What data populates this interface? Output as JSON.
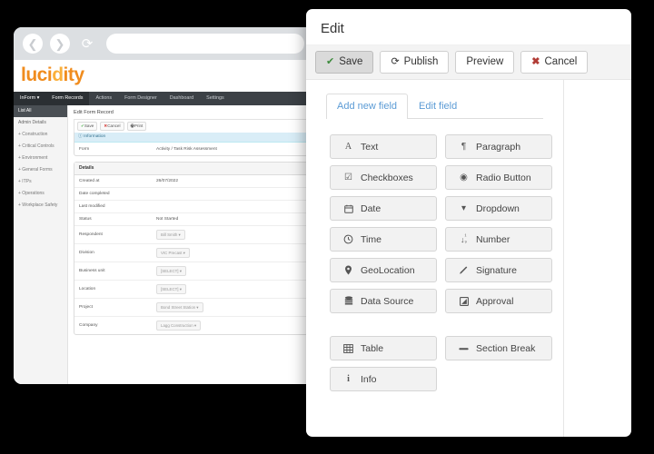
{
  "browser": {
    "back_icon": "chevron-left-icon",
    "forward_icon": "chevron-right-icon",
    "reload_icon": "reload-icon",
    "url_value": "",
    "url_placeholder": ""
  },
  "app": {
    "logo_part1": "luci",
    "logo_part2": "d",
    "logo_part3": "ity",
    "nav": [
      {
        "label": "InForm ▾",
        "active": true
      },
      {
        "label": "Form Records",
        "active": true
      },
      {
        "label": "Actions",
        "active": false
      },
      {
        "label": "Form Designer",
        "active": false
      },
      {
        "label": "Dashboard",
        "active": false
      },
      {
        "label": "Settings",
        "active": false
      }
    ],
    "sidebar": [
      {
        "label": "List All",
        "active": true
      },
      {
        "label": "Admin Details",
        "active": false
      },
      {
        "label": "+ Construction",
        "active": false
      },
      {
        "label": "+ Critical Controls",
        "active": false
      },
      {
        "label": "+ Environment",
        "active": false
      },
      {
        "label": "+ General Forms",
        "active": false
      },
      {
        "label": "+ ITPs",
        "active": false
      },
      {
        "label": "+ Operations",
        "active": false
      },
      {
        "label": "+ Workplace Safety",
        "active": false
      }
    ],
    "record": {
      "title": "Edit Form Record",
      "toolbar": [
        {
          "label": "Save",
          "icon": "check-icon"
        },
        {
          "label": "Cancel",
          "icon": "cross-icon"
        },
        {
          "label": "Print",
          "icon": "printer-icon"
        }
      ],
      "information_header": "Information",
      "information_icon": "info-icon",
      "information_rows": [
        {
          "label": "Form",
          "value": "Activity / Task Risk Assessment",
          "type": "text"
        }
      ],
      "details_header": "Details",
      "details_rows": [
        {
          "label": "Created at",
          "value": "26/07/2022",
          "type": "text"
        },
        {
          "label": "Date completed",
          "value": "",
          "type": "text"
        },
        {
          "label": "Last modified",
          "value": "",
          "type": "text"
        },
        {
          "label": "Status",
          "value": "Not Started",
          "type": "text"
        },
        {
          "label": "Respondent",
          "value": "Bill Smith ▾",
          "type": "pill"
        },
        {
          "label": "Division",
          "value": "VIC Precast ▾",
          "type": "pill"
        },
        {
          "label": "Business unit",
          "value": "[SELECT] ▾",
          "type": "pill"
        },
        {
          "label": "Location",
          "value": "[SELECT] ▾",
          "type": "pill"
        },
        {
          "label": "Project",
          "value": "Bond Street Station ▾",
          "type": "pill"
        },
        {
          "label": "Company",
          "value": "Lagg Construction ▾",
          "type": "pill"
        }
      ]
    }
  },
  "modal": {
    "title": "Edit",
    "toolbar": [
      {
        "label": "Save",
        "icon": "check-icon",
        "icon_glyph": "✔",
        "icon_color": "green",
        "pressed": true
      },
      {
        "label": "Publish",
        "icon": "publish-icon",
        "icon_glyph": "⟳",
        "icon_color": "dark",
        "pressed": false
      },
      {
        "label": "Preview",
        "icon": "",
        "icon_glyph": "",
        "icon_color": "dark",
        "pressed": false
      },
      {
        "label": "Cancel",
        "icon": "cross-icon",
        "icon_glyph": "✖",
        "icon_color": "red",
        "pressed": false
      }
    ],
    "tabs": [
      {
        "label": "Add new field",
        "active": true
      },
      {
        "label": "Edit field",
        "active": false
      }
    ],
    "field_buttons": [
      {
        "label": "Text",
        "icon": "text-a-icon",
        "glyph": "A"
      },
      {
        "label": "Paragraph",
        "icon": "paragraph-icon",
        "glyph": "¶"
      },
      {
        "label": "Checkboxes",
        "icon": "checkbox-icon",
        "glyph": "☑"
      },
      {
        "label": "Radio Button",
        "icon": "radio-button-icon",
        "glyph": "◉"
      },
      {
        "label": "Date",
        "icon": "calendar-icon",
        "glyph": "Ὄ5"
      },
      {
        "label": "Dropdown",
        "icon": "caret-down-icon",
        "glyph": "▾"
      },
      {
        "label": "Time",
        "icon": "clock-icon",
        "glyph": "◴"
      },
      {
        "label": "Number",
        "icon": "sort-numeric-icon",
        "glyph": "↓₁₉"
      },
      {
        "label": "GeoLocation",
        "icon": "map-pin-icon",
        "glyph": "⚓"
      },
      {
        "label": "Signature",
        "icon": "pencil-icon",
        "glyph": "✐"
      },
      {
        "label": "Data Source",
        "icon": "database-icon",
        "glyph": "≣"
      },
      {
        "label": "Approval",
        "icon": "approval-icon",
        "glyph": "◩"
      },
      {
        "label": "Table",
        "icon": "table-icon",
        "glyph": "⊞"
      },
      {
        "label": "Section Break",
        "icon": "minus-icon",
        "glyph": "▂"
      },
      {
        "label": "Info",
        "icon": "info-icon",
        "glyph": "i"
      }
    ],
    "field_button_break_after": 11,
    "colors": {
      "tab_link": "#5b9bd5",
      "save_check": "#3d8b3d",
      "cancel_cross": "#b13c36",
      "button_face": "#f2f2f2"
    }
  }
}
